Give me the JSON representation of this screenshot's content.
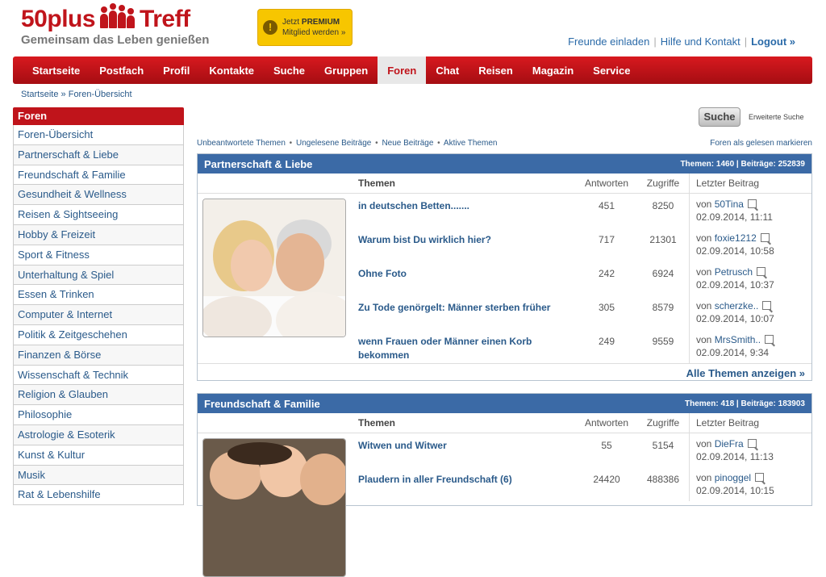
{
  "logo": {
    "title_a": "50plus",
    "title_b": "Treff",
    "subtitle": "Gemeinsam das Leben genießen"
  },
  "premium": {
    "line1": "Jetzt",
    "line1_bold": "PREMIUM",
    "line2": "Mitglied werden »"
  },
  "toplinks": {
    "invite": "Freunde einladen",
    "help": "Hilfe und Kontakt",
    "logout": "Logout »",
    "sep": "|"
  },
  "nav": [
    "Startseite",
    "Postfach",
    "Profil",
    "Kontakte",
    "Suche",
    "Gruppen",
    "Foren",
    "Chat",
    "Reisen",
    "Magazin",
    "Service"
  ],
  "breadcrumb": {
    "home": "Startseite",
    "sep": "»",
    "current": "Foren-Übersicht"
  },
  "sidebar": {
    "title": "Foren",
    "items": [
      "Foren-Übersicht",
      "Partnerschaft & Liebe",
      "Freundschaft & Familie",
      "Gesundheit & Wellness",
      "Reisen & Sightseeing",
      "Hobby & Freizeit",
      "Sport & Fitness",
      "Unterhaltung & Spiel",
      "Essen & Trinken",
      "Computer & Internet",
      "Politik & Zeitgeschehen",
      "Finanzen & Börse",
      "Wissenschaft & Technik",
      "Religion & Glauben",
      "Philosophie",
      "Astrologie & Esoterik",
      "Kunst & Kultur",
      "Musik",
      "Rat & Lebenshilfe"
    ]
  },
  "search": {
    "button": "Suche",
    "advanced": "Erweiterte Suche"
  },
  "quicklinks": [
    "Unbeantwortete Themen",
    "Ungelesene Beiträge",
    "Neue Beiträge",
    "Aktive Themen"
  ],
  "quicklinks_sep": "•",
  "markread": "Foren als gelesen markieren",
  "columns": {
    "topics": "Themen",
    "answers": "Antworten",
    "views": "Zugriffe",
    "last": "Letzter Beitrag"
  },
  "forums": [
    {
      "title": "Partnerschaft & Liebe",
      "stats": "Themen: 1460 | Beiträge: 252839",
      "footer": "Alle Themen anzeigen »",
      "rows": [
        {
          "topic": "in deutschen Betten.......",
          "answers": "451",
          "views": "8250",
          "by": "von",
          "user": "50Tina",
          "date": "02.09.2014, 11:11"
        },
        {
          "topic": "Warum bist Du wirklich hier?",
          "answers": "717",
          "views": "21301",
          "by": "von",
          "user": "foxie1212",
          "date": "02.09.2014, 10:58"
        },
        {
          "topic": "Ohne Foto",
          "answers": "242",
          "views": "6924",
          "by": "von",
          "user": "Petrusch",
          "date": "02.09.2014, 10:37"
        },
        {
          "topic": "Zu Tode genörgelt: Männer sterben früher",
          "answers": "305",
          "views": "8579",
          "by": "von",
          "user": "scherzke..",
          "date": "02.09.2014, 10:07"
        },
        {
          "topic": "wenn Frauen oder Männer einen Korb bekommen",
          "answers": "249",
          "views": "9559",
          "by": "von",
          "user": "MrsSmith..",
          "date": "02.09.2014, 9:34"
        }
      ]
    },
    {
      "title": "Freundschaft & Familie",
      "stats": "Themen: 418 | Beiträge: 183903",
      "rows": [
        {
          "topic": "Witwen und Witwer",
          "answers": "55",
          "views": "5154",
          "by": "von",
          "user": "DieFra",
          "date": "02.09.2014, 11:13"
        },
        {
          "topic": "Plaudern in aller Freundschaft (6)",
          "answers": "24420",
          "views": "488386",
          "by": "von",
          "user": "pinoggel",
          "date": "02.09.2014, 10:15"
        }
      ]
    }
  ],
  "colors": {
    "brand_red": "#c0141b",
    "forum_blue": "#3b6aa6",
    "link": "#2a5a8a",
    "premium_yellow": "#f7c600"
  }
}
